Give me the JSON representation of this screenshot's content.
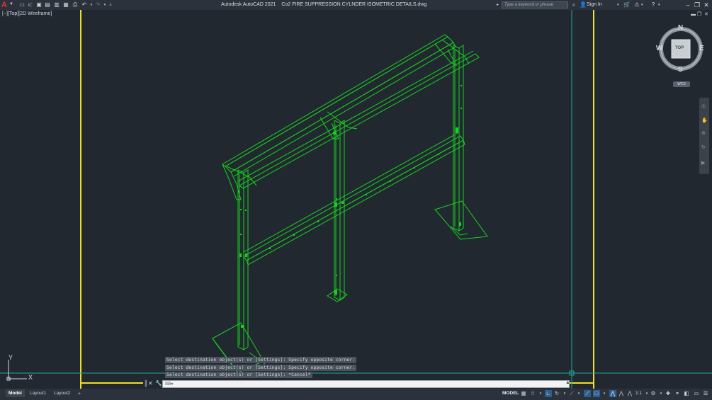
{
  "titlebar": {
    "app_logo": "A",
    "app_name": "Autodesk AutoCAD 2021",
    "file_name": "Co2 FIRE SUPPRESSION CYLNDER ISOMETRIC DETAILS.dwg",
    "search_placeholder": "Type a keyword or phrase",
    "sign_in": "Sign In"
  },
  "viewport": {
    "label": "[−][Top][2D Wireframe]",
    "ucs_x": "X",
    "ucs_y": "Y"
  },
  "viewcube": {
    "north": "N",
    "south": "S",
    "east": "E",
    "west": "W",
    "face": "TOP",
    "wcs": "WCS"
  },
  "command": {
    "history": [
      "Select destination object(s) or [Settings]: Specify opposite corner:",
      "Select destination object(s) or [Settings]: Specify opposite corner:",
      "Select destination object(s) or [Settings]: *Cancel*"
    ],
    "placeholder": ""
  },
  "layout_tabs": [
    {
      "label": "Model",
      "active": true
    },
    {
      "label": "Layout1",
      "active": false
    },
    {
      "label": "Layout2",
      "active": false
    }
  ],
  "status": {
    "model": "MODEL",
    "scale": "1:1",
    "anno": "1"
  },
  "colors": {
    "background": "#212830",
    "geometry": "#19d11e",
    "boundary": "#f0e020",
    "accent": "#2e5d8f"
  }
}
